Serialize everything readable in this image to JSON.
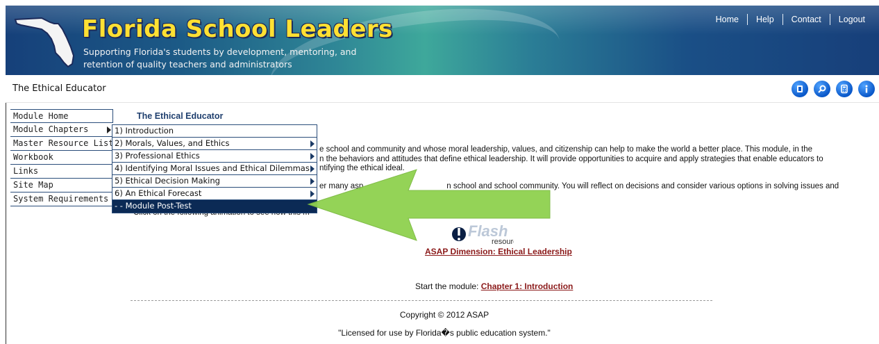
{
  "header": {
    "title": "Florida School Leaders",
    "tagline_line1": "Supporting Florida's students by development, mentoring, and",
    "tagline_line2": "retention of quality teachers and administrators",
    "nav": [
      "Home",
      "Help",
      "Contact",
      "Logout"
    ]
  },
  "subbar": {
    "title": "The Ethical Educator",
    "icons": [
      "book-icon",
      "search-icon",
      "calculator-icon",
      "info-icon"
    ]
  },
  "left_menu": [
    {
      "label": "Module Home"
    },
    {
      "label": "Module Chapters",
      "has_submenu": true
    },
    {
      "label": "Master Resource List"
    },
    {
      "label": "Workbook"
    },
    {
      "label": "Links"
    },
    {
      "label": "Site Map"
    },
    {
      "label": "System Requirements"
    }
  ],
  "submenu": [
    {
      "label": "1) Introduction",
      "has_submenu": false
    },
    {
      "label": "2) Morals, Values, and Ethics",
      "has_submenu": true
    },
    {
      "label": "3) Professional Ethics",
      "has_submenu": true
    },
    {
      "label": "4) Identifying Moral Issues and Ethical Dilemmas",
      "has_submenu": true
    },
    {
      "label": "5) Ethical Decision Making",
      "has_submenu": true
    },
    {
      "label": "6) An Ethical Forecast",
      "has_submenu": true
    },
    {
      "label": "- - Module Post-Test",
      "has_submenu": false,
      "active": true
    }
  ],
  "main": {
    "heading": "The Ethical Educator",
    "p1_line1": "e school and community and whose moral leadership, values, and citizenship can help to make the world a better place. This module, in the",
    "p1_line2": "n the behaviors and attitudes that define ethical leadership. It will provide opportunities to acquire and apply strategies that enable educators to",
    "p1_line3": "ntifying the ethical ideal.",
    "p2_line1": "er many asp",
    "p2_line1b": "n school and school community. You will reflect on decisions and consider various options in solving issues and",
    "p3": "Click on the following animation to see how this m",
    "flash_word": "Flash",
    "flash_sub": "resource",
    "flash_link": "ASAP Dimension: Ethical Leadership",
    "start_prefix": "Start the module: ",
    "start_link": "Chapter 1: Introduction",
    "copyright": "Copyright © 2012 ASAP",
    "license": "\"Licensed for use by Florida�s public education system.\""
  },
  "colors": {
    "title_yellow": "#ffe033",
    "link_red": "#8b1a1a",
    "menu_active": "#0b2a55",
    "arrow_green": "#8fd14f"
  }
}
